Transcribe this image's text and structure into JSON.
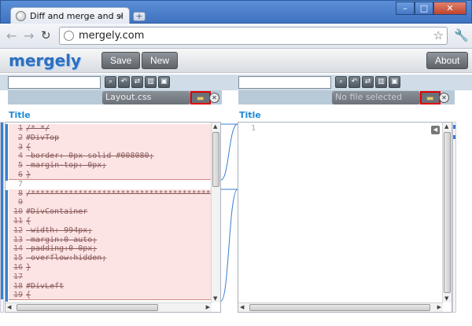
{
  "browser": {
    "tab_title": "Diff and merge and share",
    "tab_close": "×",
    "newtab": "+",
    "url": "mergely.com",
    "winbtn_min": "–",
    "winbtn_max": "□",
    "winbtn_close": "✕"
  },
  "app": {
    "logo": "mergely",
    "save_label": "Save",
    "new_label": "New",
    "about_label": "About"
  },
  "left": {
    "filename": "Layout.css",
    "title": "Title",
    "lines": [
      {
        "n": "1",
        "t": "/*                        */",
        "del": true
      },
      {
        "n": "2",
        "t": "#DivTop",
        "del": true
      },
      {
        "n": "3",
        "t": "{",
        "del": true
      },
      {
        "n": "4",
        "t": "    border: 0px solid #008080;",
        "del": true
      },
      {
        "n": "5",
        "t": "    margin-top: 0px;",
        "del": true
      },
      {
        "n": "6",
        "t": "}",
        "del": true
      },
      {
        "n": "7",
        "t": "",
        "del": false
      },
      {
        "n": "8",
        "t": "/**************************************",
        "del": true
      },
      {
        "n": "9",
        "t": "",
        "del": true
      },
      {
        "n": "10",
        "t": "#DivContainer",
        "del": true
      },
      {
        "n": "11",
        "t": "{",
        "del": true
      },
      {
        "n": "12",
        "t": "    width: 994px;",
        "del": true
      },
      {
        "n": "13",
        "t": "    margin:0 auto;",
        "del": true
      },
      {
        "n": "14",
        "t": "    padding:0 0px;",
        "del": true
      },
      {
        "n": "15",
        "t": "    overflow:hidden;",
        "del": true
      },
      {
        "n": "16",
        "t": "}",
        "del": true
      },
      {
        "n": "17",
        "t": "",
        "del": true
      },
      {
        "n": "18",
        "t": "#DivLeft",
        "del": true
      },
      {
        "n": "19",
        "t": "{",
        "del": true
      }
    ]
  },
  "right": {
    "filename": "No file selected",
    "title": "Title",
    "lines": [
      {
        "n": "1",
        "t": ""
      }
    ]
  }
}
